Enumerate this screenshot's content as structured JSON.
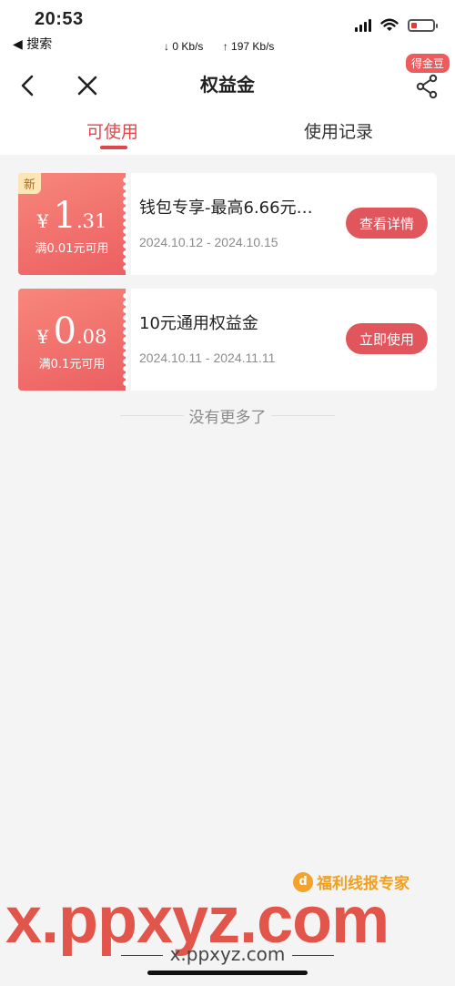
{
  "status_bar": {
    "time": "20:53",
    "back_app": "◀ 搜索",
    "download_speed": "↓ 0 Kb/s",
    "upload_speed": "↑ 197 Kb/s"
  },
  "nav": {
    "title": "权益金",
    "badge": "得金豆",
    "back_icon": "chevron-left-icon",
    "close_icon": "close-icon",
    "share_icon": "share-icon"
  },
  "tabs": [
    {
      "label": "可使用",
      "active": true
    },
    {
      "label": "使用记录",
      "active": false
    }
  ],
  "coupons": [
    {
      "badge": "新",
      "currency": "¥",
      "amount_int": "1",
      "amount_dec": ".31",
      "threshold": "满0.01元可用",
      "title": "钱包专享-最高6.66元…",
      "dates": "2024.10.12 - 2024.10.15",
      "button": "查看详情"
    },
    {
      "currency": "¥",
      "amount_int": "0",
      "amount_dec": ".08",
      "threshold": "满0.1元可用",
      "title": "10元通用权益金",
      "dates": "2024.10.11 - 2024.11.11",
      "button": "立即使用"
    }
  ],
  "footer_note": "没有更多了",
  "watermark": {
    "brand": "福利线报专家",
    "big": "x.ppxyz.com",
    "url": "x.ppxyz.com"
  },
  "colors": {
    "accent": "#e1464a",
    "coupon_gradient_start": "#f7877b",
    "coupon_gradient_end": "#ec5f62",
    "button": "#e1555c"
  }
}
